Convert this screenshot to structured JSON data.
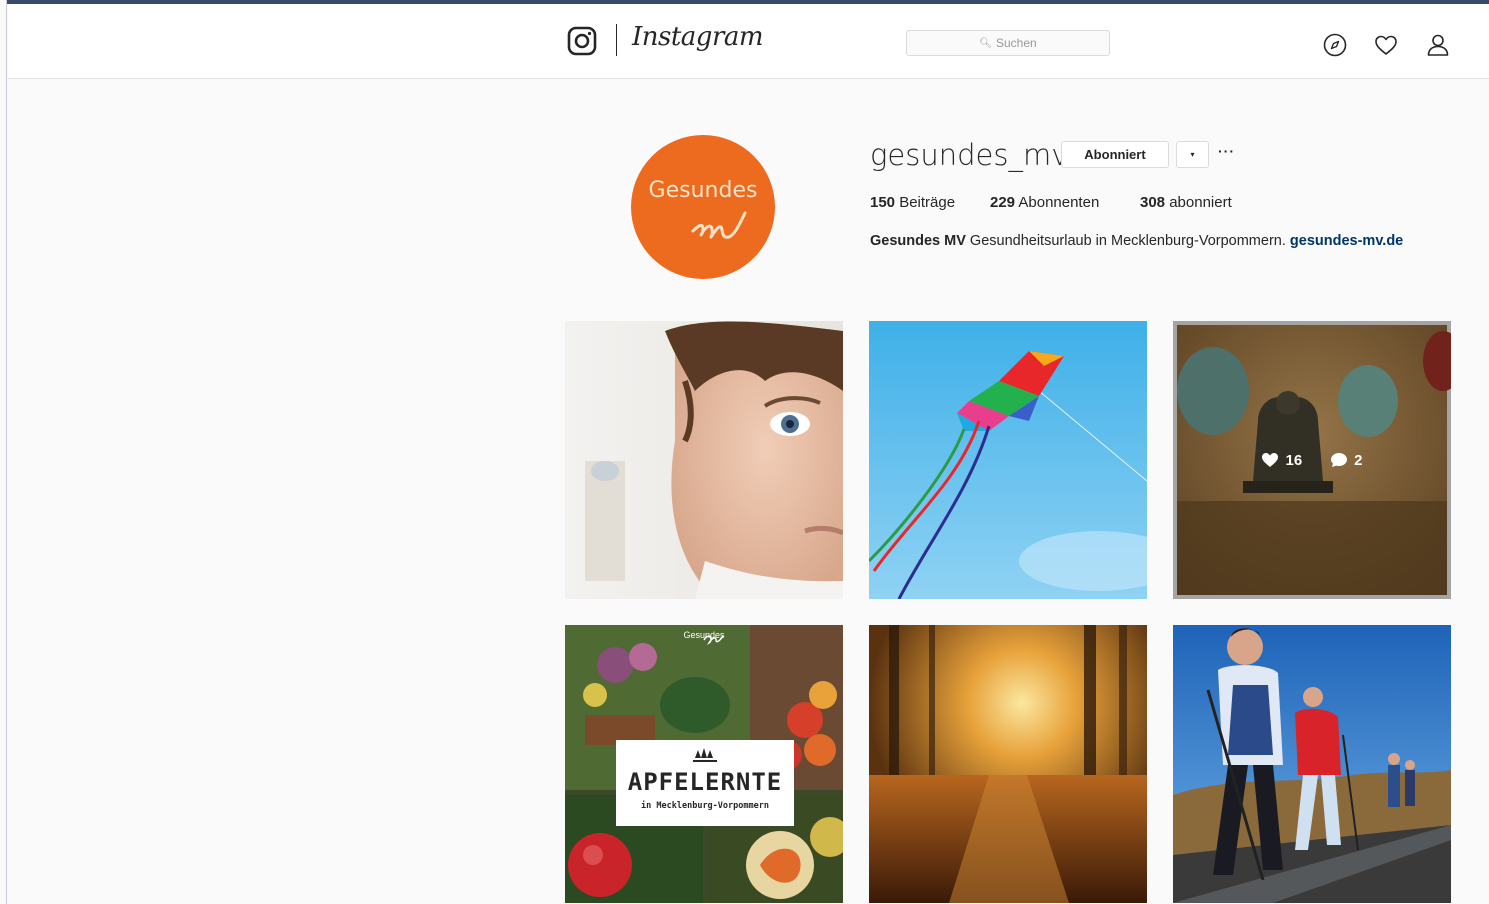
{
  "header": {
    "logo_wordmark": "Instagram",
    "search_placeholder": "Suchen",
    "nav_icons": [
      "compass-icon",
      "heart-icon",
      "profile-icon"
    ]
  },
  "profile": {
    "avatar_text": "Gesundes",
    "username": "gesundes_mv",
    "follow_label": "Abonniert",
    "dropdown_label": "▾",
    "more_label": "···",
    "stats": {
      "posts_count": "150",
      "posts_label": "Beiträge",
      "followers_count": "229",
      "followers_label": "Abonnenten",
      "following_count": "308",
      "following_label": "abonniert"
    },
    "bio": {
      "name": "Gesundes MV",
      "text": "Gesundheitsurlaub in Mecklenburg-Vorpommern.",
      "link": "gesundes-mv.de"
    }
  },
  "posts": [
    {
      "subject": "man-face-photo"
    },
    {
      "subject": "kite-sky-photo"
    },
    {
      "subject": "buddha-cupping-photo",
      "likes": "16",
      "comments": "2"
    },
    {
      "subject": "apple-harvest-photo",
      "brand": "Gesundes",
      "title": "APFELERNTE",
      "subtitle": "in Mecklenburg-Vorpommern"
    },
    {
      "subject": "autumn-forest-photo"
    },
    {
      "subject": "nordic-walking-photo"
    }
  ],
  "colors": {
    "brand_orange": "#ec6b1e",
    "link_blue": "#003569"
  }
}
